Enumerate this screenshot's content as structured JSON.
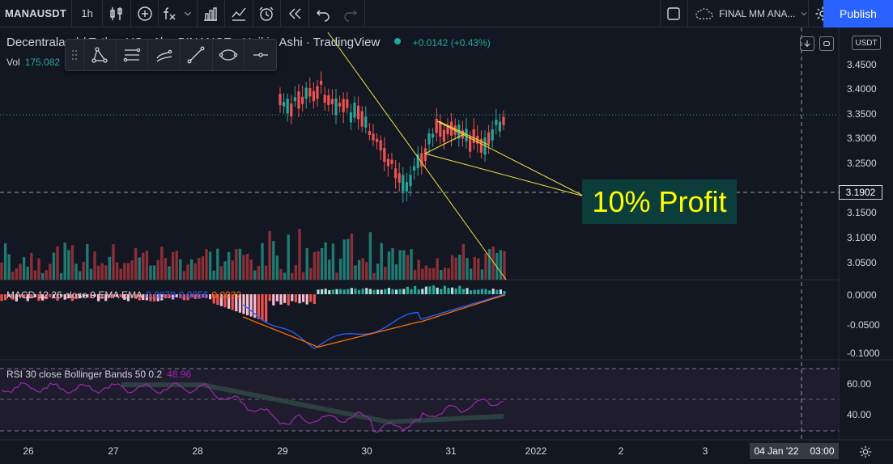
{
  "toolbar": {
    "symbol": "MANAUSDT",
    "interval": "1h",
    "layout_name": "FINAL MM ANA...",
    "publish_label": "Publish"
  },
  "legend": {
    "title": "Decentraland / Tether US · 1h · BINANCE · Heikin Ashi · TradingView",
    "change": "+0.0142 (+0.43%)",
    "vol_label": "Vol",
    "vol_value": "175.082"
  },
  "currency_badge": "USDT",
  "macd_legend": {
    "label": "MACD 12 26 close 9 EMA EMA",
    "hist": "0.0078",
    "macd": "0.0056",
    "signal": "0.0022"
  },
  "rsi_legend": {
    "label": "RSI 30 close Bollinger Bands 50 0.2",
    "value": "48.96"
  },
  "price_axis": [
    "3.4500",
    "3.4000",
    "3.3500",
    "3.3000",
    "3.2500",
    "3.1500",
    "3.1000",
    "3.0500"
  ],
  "macd_axis": [
    "0.0000",
    "-0.0500",
    "-0.1000"
  ],
  "rsi_axis": [
    "60.00",
    "40.00"
  ],
  "crosshair_price": "3.1902",
  "time_axis": [
    "26",
    "27",
    "28",
    "29",
    "30",
    "31",
    "2022",
    "2",
    "3"
  ],
  "crosshair_time": {
    "date": "04 Jan '22",
    "time": "03:00"
  },
  "annotation": "10% Profit",
  "colors": {
    "background": "#131722",
    "up": "#26a69a",
    "down": "#ef5350",
    "accent": "#2962ff",
    "trendline": "#f0e040",
    "annotation_text": "#ffff00",
    "annotation_bg": "#0b3d3a"
  },
  "icons": {
    "toolbar": [
      "candles-icon",
      "add-indicator-icon",
      "fx-icon",
      "chevron-down-icon",
      "bar-chart-icon",
      "alert-line-icon",
      "alarm-icon",
      "replay-icon",
      "undo-icon",
      "redo-icon",
      "layout-square-icon",
      "cloud-icon",
      "settings-gear-icon",
      "fullscreen-icon",
      "camera-icon"
    ],
    "drawing": [
      "pattern-icon",
      "parallel-channel-icon",
      "curve-lines-icon",
      "trend-line-icon",
      "ellipse-icon",
      "horizontal-ray-icon"
    ]
  }
}
